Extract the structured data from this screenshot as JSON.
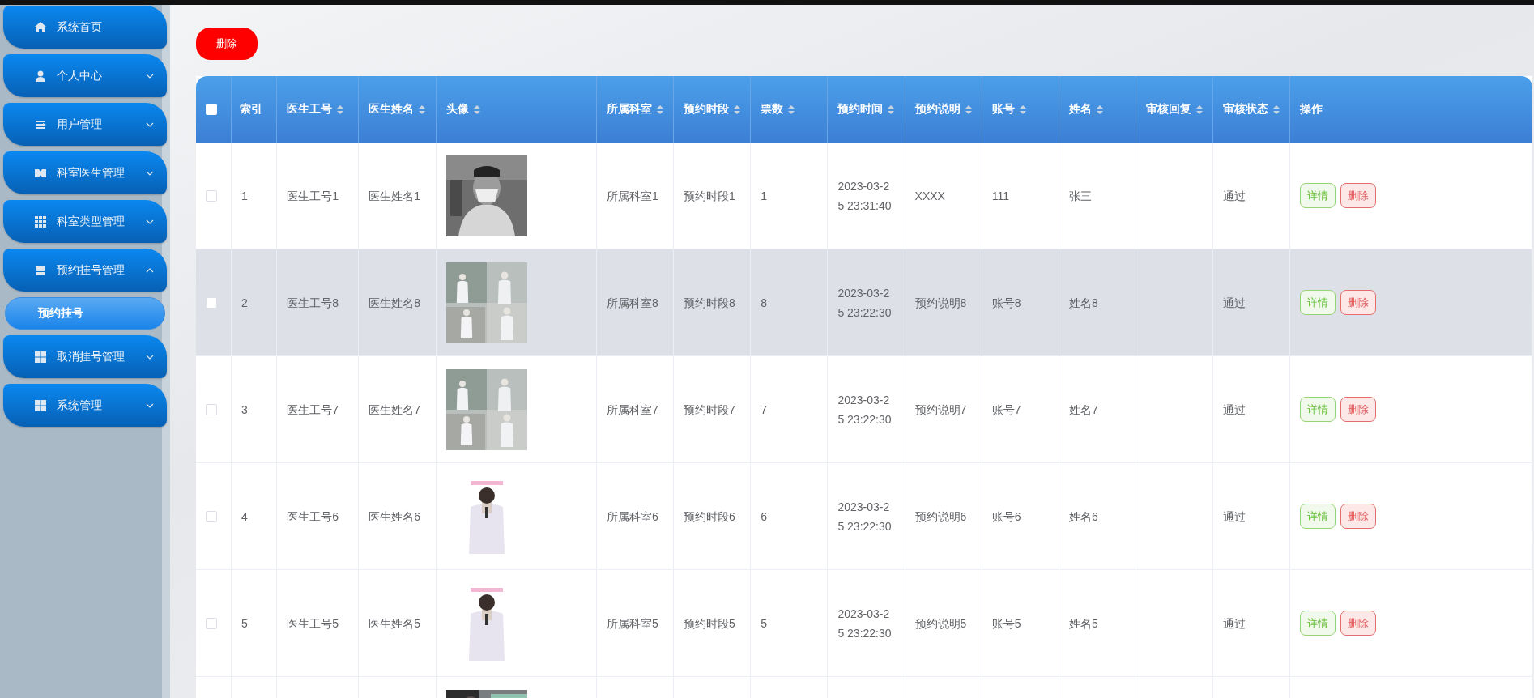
{
  "sidebar": {
    "items": [
      {
        "label": "系统首页"
      },
      {
        "label": "个人中心",
        "expanded": false
      },
      {
        "label": "用户管理",
        "expanded": false
      },
      {
        "label": "科室医生管理",
        "expanded": false
      },
      {
        "label": "科室类型管理",
        "expanded": false
      },
      {
        "label": "预约挂号管理",
        "expanded": true,
        "children": [
          {
            "label": "预约挂号",
            "selected": true
          }
        ]
      },
      {
        "label": "取消挂号管理",
        "expanded": false
      },
      {
        "label": "系统管理",
        "expanded": false
      }
    ]
  },
  "toolbar": {
    "delete_button": "删除"
  },
  "table": {
    "select_all": {
      "checked": false
    },
    "columns": [
      {
        "label": "索引",
        "sortable": false
      },
      {
        "label": "医生工号",
        "sortable": true
      },
      {
        "label": "医生姓名",
        "sortable": true
      },
      {
        "label": "头像",
        "sortable": true,
        "kind": "picture"
      },
      {
        "label": "所属科室",
        "sortable": true
      },
      {
        "label": "预约时段",
        "sortable": true
      },
      {
        "label": "票数",
        "sortable": true
      },
      {
        "label": "预约时间",
        "sortable": true
      },
      {
        "label": "预约说明",
        "sortable": true
      },
      {
        "label": "账号",
        "sortable": true
      },
      {
        "label": "姓名",
        "sortable": true
      },
      {
        "label": "审核回复",
        "sortable": true
      },
      {
        "label": "审核状态",
        "sortable": true
      },
      {
        "label": "操作",
        "sortable": false,
        "kind": "actions"
      }
    ],
    "rows": [
      {
        "checked": false,
        "highlighted": false,
        "cells": [
          "1",
          "医生工号1",
          "医生姓名1",
          null,
          "所属科室1",
          "预约时段1",
          "1",
          "2023-03-25 23:31:40",
          "XXXX",
          "111",
          "张三",
          null,
          "通过"
        ],
        "avatar": {
          "kind": "picture"
        },
        "actions": [
          {
            "kind": "detail",
            "label": "详情"
          },
          {
            "kind": "delete",
            "label": "删除"
          }
        ]
      },
      {
        "checked": false,
        "highlighted": true,
        "cells": [
          "2",
          "医生工号8",
          "医生姓名8",
          null,
          "所属科室8",
          "预约时段8",
          "8",
          "2023-03-25 23:22:30",
          "预约说明8",
          "账号8",
          "姓名8",
          null,
          "通过"
        ],
        "avatar": {
          "kind": "picture"
        },
        "actions": [
          {
            "kind": "detail",
            "label": "详情"
          },
          {
            "kind": "delete",
            "label": "删除"
          }
        ]
      },
      {
        "checked": false,
        "highlighted": false,
        "cells": [
          "3",
          "医生工号7",
          "医生姓名7",
          null,
          "所属科室7",
          "预约时段7",
          "7",
          "2023-03-25 23:22:30",
          "预约说明7",
          "账号7",
          "姓名7",
          null,
          "通过"
        ],
        "avatar": {
          "kind": "picture"
        },
        "actions": [
          {
            "kind": "detail",
            "label": "详情"
          },
          {
            "kind": "delete",
            "label": "删除"
          }
        ]
      },
      {
        "checked": false,
        "highlighted": false,
        "cells": [
          "4",
          "医生工号6",
          "医生姓名6",
          null,
          "所属科室6",
          "预约时段6",
          "6",
          "2023-03-25 23:22:30",
          "预约说明6",
          "账号6",
          "姓名6",
          null,
          "通过"
        ],
        "avatar": {
          "kind": "picture"
        },
        "actions": [
          {
            "kind": "detail",
            "label": "详情"
          },
          {
            "kind": "delete",
            "label": "删除"
          }
        ]
      },
      {
        "checked": false,
        "highlighted": false,
        "cells": [
          "5",
          "医生工号5",
          "医生姓名5",
          null,
          "所属科室5",
          "预约时段5",
          "5",
          "2023-03-25 23:22:30",
          "预约说明5",
          "账号5",
          "姓名5",
          null,
          "通过"
        ],
        "avatar": {
          "kind": "picture"
        },
        "actions": [
          {
            "kind": "detail",
            "label": "详情"
          },
          {
            "kind": "delete",
            "label": "删除"
          }
        ]
      },
      {
        "avatar": {
          "kind": "picture"
        }
      }
    ]
  }
}
